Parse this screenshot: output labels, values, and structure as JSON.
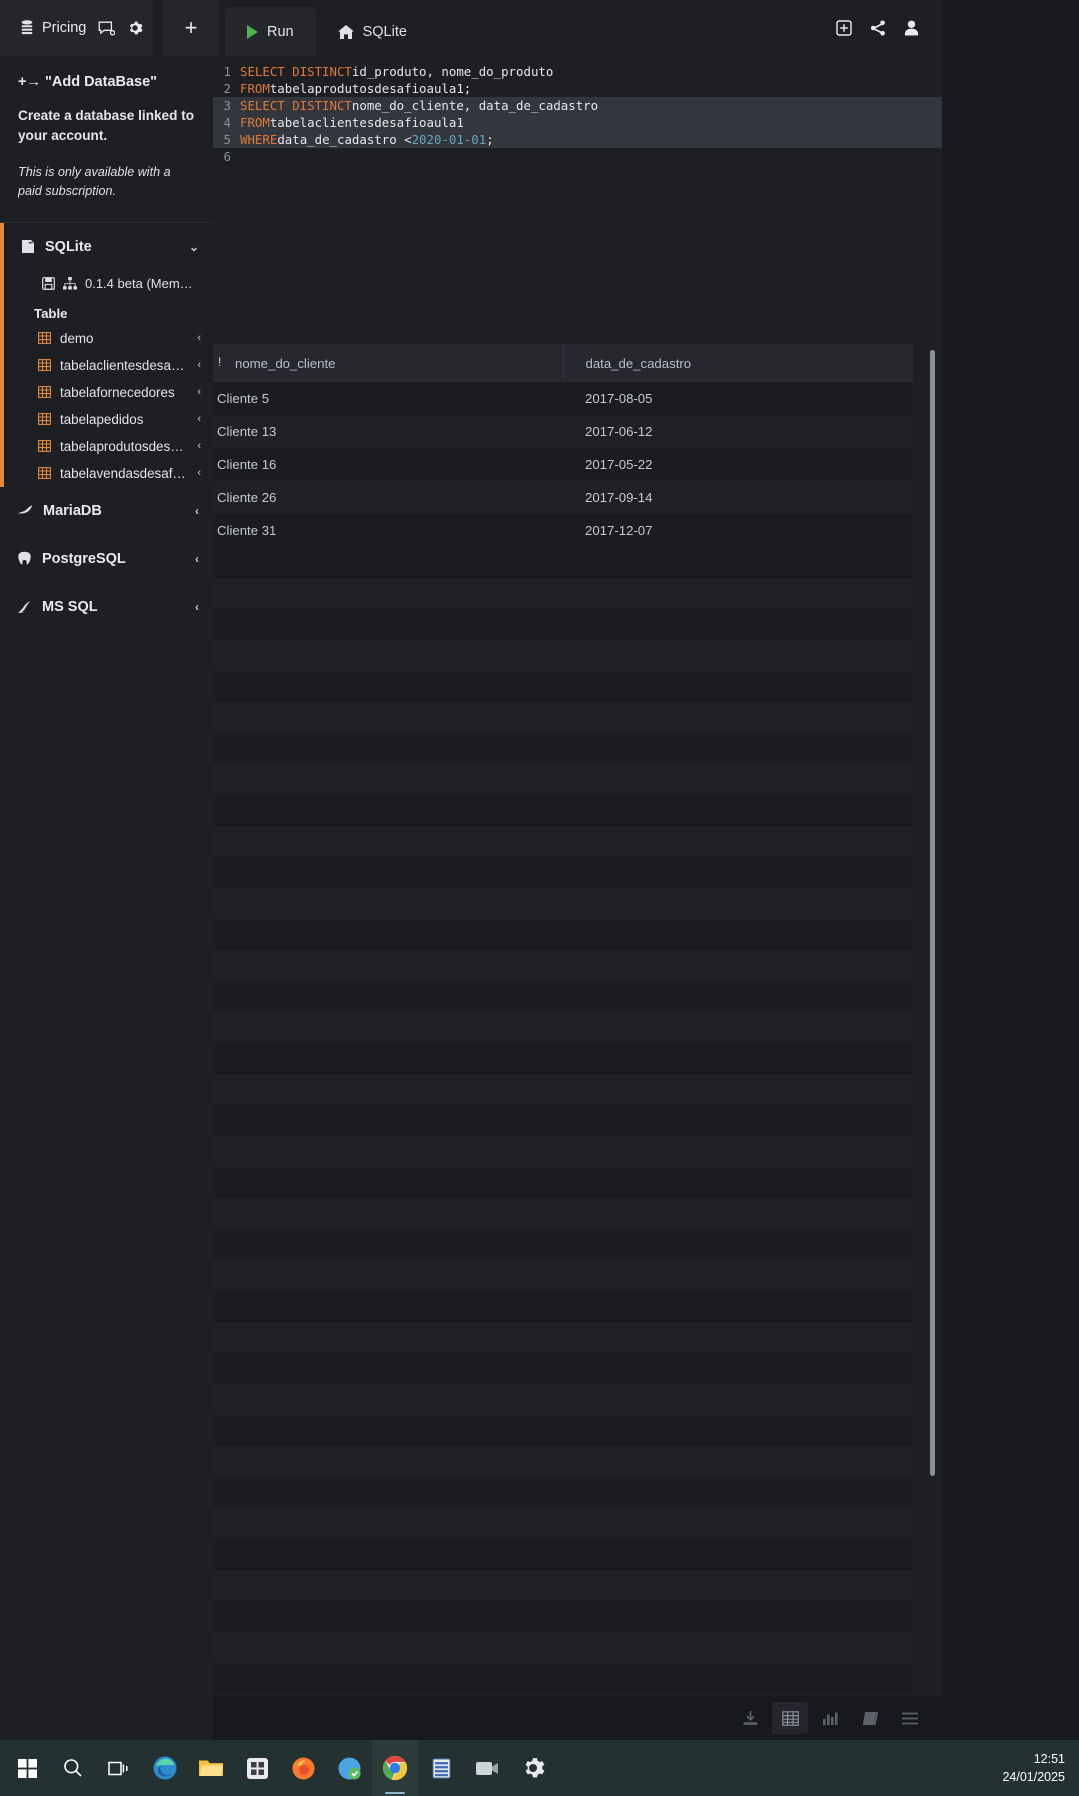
{
  "topbar": {
    "pricing_label": "Pricing",
    "db_icon": "database-icon",
    "chat_icon": "chat-icon",
    "gear_icon": "gear-icon",
    "new_tab_label": "+",
    "right_icons": [
      "add-box-icon",
      "share-icon",
      "account-icon"
    ]
  },
  "tabs": [
    {
      "label": "Run",
      "icon": "play-icon",
      "active": true
    },
    {
      "label": "SQLite",
      "icon": "home-icon",
      "active": false
    }
  ],
  "sidebar": {
    "promo": {
      "add_database": "+→ \"Add DataBase\"",
      "description": "Create a database linked to your account.",
      "note": "This is only available with a paid subscription."
    },
    "sections": [
      {
        "name": "SQLite",
        "icon": "sqlite-icon",
        "chevron": "chevron-down-icon",
        "expanded": true,
        "version": "0.1.4 beta (Mem…",
        "version_icons": [
          "save-icon",
          "sitemap-icon"
        ],
        "group_label": "Table",
        "tables": [
          {
            "label": "demo"
          },
          {
            "label": "tabelaclientesdesafioau…"
          },
          {
            "label": "tabelafornecedores"
          },
          {
            "label": "tabelapedidos"
          },
          {
            "label": "tabelaprodutosdesafioa…"
          },
          {
            "label": "tabelavendasdesafioaul…"
          }
        ]
      },
      {
        "name": "MariaDB",
        "icon": "mariadb-icon",
        "chevron": "chevron-left-icon",
        "expanded": false
      },
      {
        "name": "PostgreSQL",
        "icon": "postgresql-icon",
        "chevron": "chevron-left-icon",
        "expanded": false
      },
      {
        "name": "MS SQL",
        "icon": "mssql-icon",
        "chevron": "chevron-left-icon",
        "expanded": false
      }
    ]
  },
  "editor": {
    "lines": [
      {
        "n": "1",
        "selected": false,
        "tokens": [
          {
            "t": "kw",
            "v": "SELECT DISTINCT"
          },
          {
            "t": "txt",
            "v": " id_produto, nome_do_produto"
          }
        ]
      },
      {
        "n": "2",
        "selected": false,
        "tokens": [
          {
            "t": "kw",
            "v": "FROM"
          },
          {
            "t": "txt",
            "v": " tabelaprodutosdesafioaula1;"
          }
        ]
      },
      {
        "n": "3",
        "selected": true,
        "tokens": [
          {
            "t": "kw",
            "v": "SELECT DISTINCT"
          },
          {
            "t": "txt",
            "v": " nome_do_cliente, data_de_cadastro"
          }
        ]
      },
      {
        "n": "4",
        "selected": true,
        "tokens": [
          {
            "t": "kw",
            "v": "FROM"
          },
          {
            "t": "txt",
            "v": " tabelaclientesdesafioaula1"
          }
        ]
      },
      {
        "n": "5",
        "selected": true,
        "tokens": [
          {
            "t": "kw",
            "v": "WHERE"
          },
          {
            "t": "txt",
            "v": "  data_de_cadastro <"
          },
          {
            "t": "num",
            "v": "2020-01-01"
          },
          {
            "t": "txt",
            "v": ";"
          }
        ]
      },
      {
        "n": "6",
        "selected": false,
        "tokens": []
      }
    ]
  },
  "results": {
    "columns": [
      "nome_do_cliente",
      "data_de_cadastro"
    ],
    "sort_indicator": "!",
    "rows": [
      [
        "Cliente 5",
        "2017-08-05"
      ],
      [
        "Cliente 13",
        "2017-06-12"
      ],
      [
        "Cliente 16",
        "2017-05-22"
      ],
      [
        "Cliente 26",
        "2017-09-14"
      ],
      [
        "Cliente 31",
        "2017-12-07"
      ]
    ],
    "toolbar_icons": [
      "download-icon",
      "table-view-icon",
      "chart-view-icon",
      "book-icon",
      "menu-icon"
    ],
    "toolbar_selected": "table-view-icon"
  },
  "taskbar": {
    "icons": [
      "windows-start-icon",
      "search-icon",
      "task-view-icon",
      "edge-icon",
      "file-explorer-icon",
      "store-icon",
      "firefox-icon",
      "sync-icon",
      "chrome-icon",
      "excel-icon",
      "teams-icon",
      "settings-icon"
    ],
    "time": "12:51",
    "date": "24/01/2025"
  },
  "colors": {
    "accent_orange": "#e08b3e",
    "keyword": "#e07a3a",
    "number": "#62a8bd",
    "run_green": "#4caf50",
    "bg": "#1d1f23",
    "panel": "#24262b"
  }
}
